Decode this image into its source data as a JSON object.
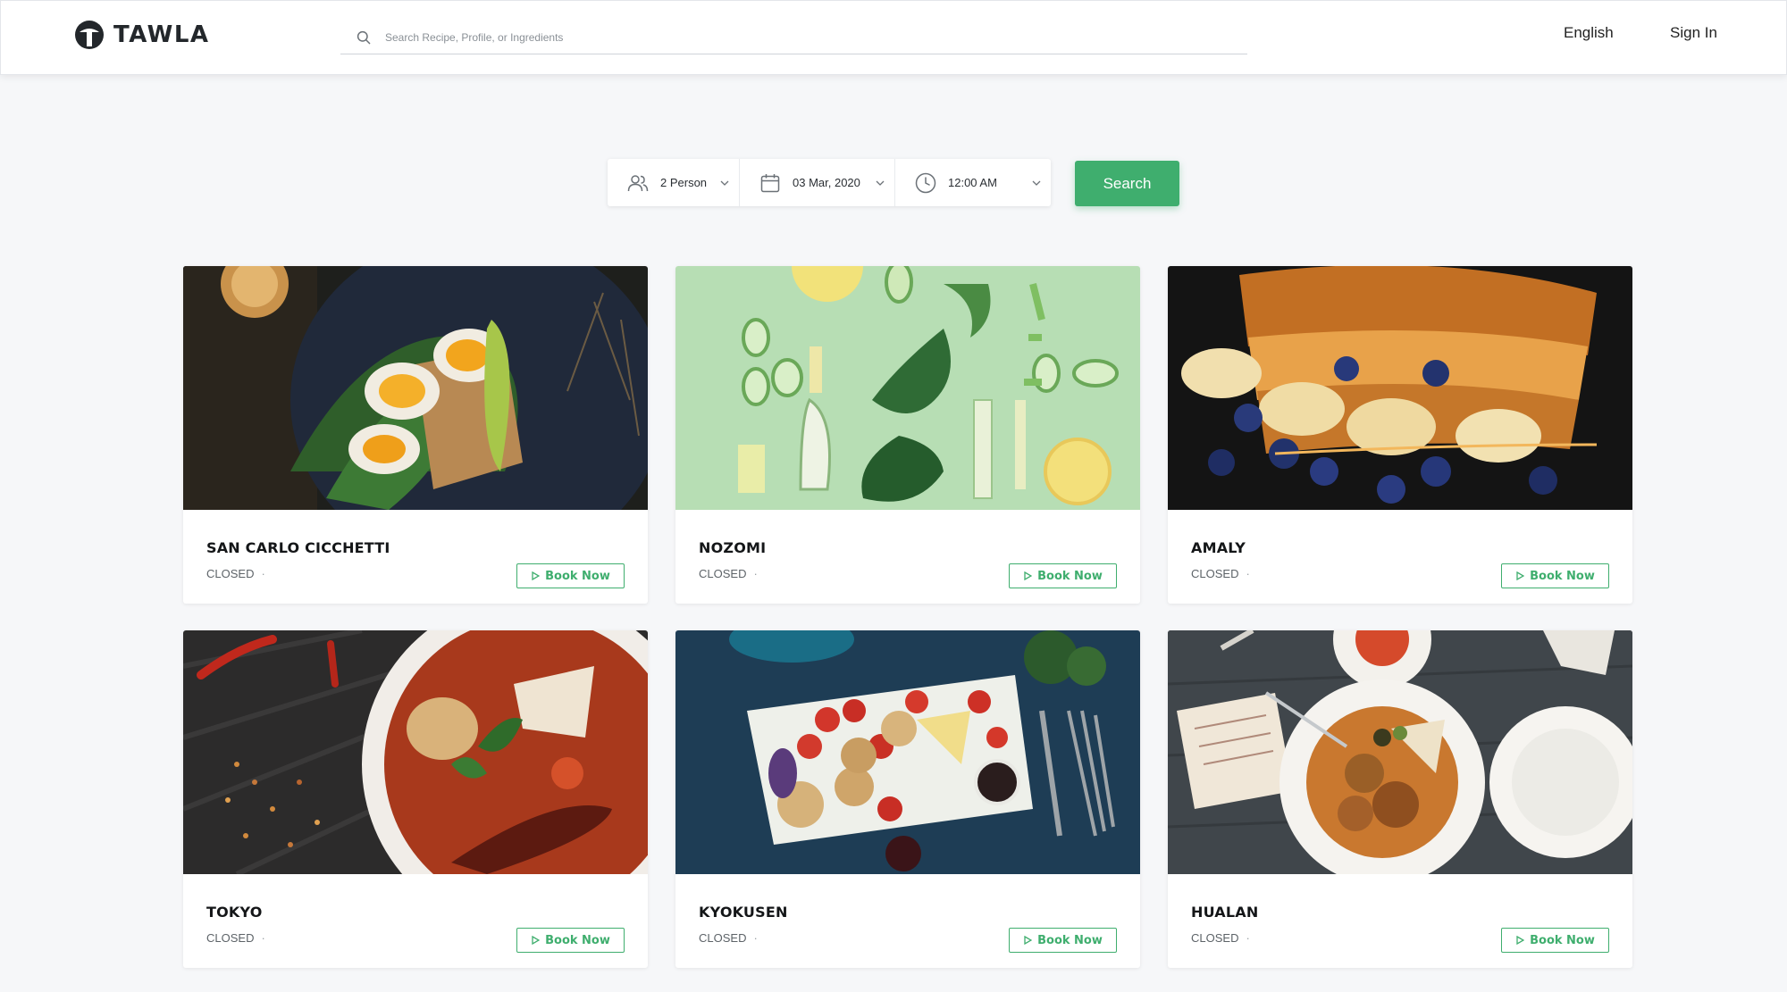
{
  "brand": {
    "name": "TAWLA",
    "accent": "#3fae6e"
  },
  "search": {
    "placeholder": "Search Recipe, Profile, or Ingredients",
    "value": ""
  },
  "nav": {
    "language": "English",
    "sign_in": "Sign In"
  },
  "booking": {
    "persons": "2 Person",
    "date": "03 Mar, 2020",
    "time": "12:00 AM",
    "search_label": "Search"
  },
  "restaurants": [
    {
      "name": "SAN CARLO CICCHETTI",
      "status": "CLOSED",
      "action": "Book Now",
      "image": "egg-avocado-toast-photo"
    },
    {
      "name": "NOZOMI",
      "status": "CLOSED",
      "action": "Book Now",
      "image": "sliced-vegetables-photo"
    },
    {
      "name": "AMALY",
      "status": "CLOSED",
      "action": "Book Now",
      "image": "french-toast-berries-photo"
    },
    {
      "name": "TOKYO",
      "status": "CLOSED",
      "action": "Book Now",
      "image": "curry-bowl-photo"
    },
    {
      "name": "KYOKUSEN",
      "status": "CLOSED",
      "action": "Book Now",
      "image": "cheese-board-photo"
    },
    {
      "name": "HUALAN",
      "status": "CLOSED",
      "action": "Book Now",
      "image": "meatball-plate-photo"
    }
  ]
}
